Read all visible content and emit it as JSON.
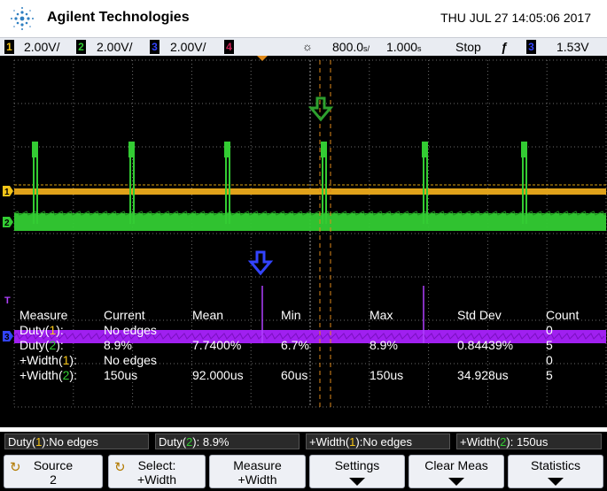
{
  "header": {
    "brand": "Agilent Technologies",
    "datetime": "THU JUL 27 14:05:06 2017"
  },
  "status": {
    "ch1": {
      "num": "1",
      "scale": "2.00V/",
      "color": "#f5c518"
    },
    "ch2": {
      "num": "2",
      "scale": "2.00V/",
      "color": "#33cc33"
    },
    "ch3": {
      "num": "3",
      "scale": "2.00V/",
      "color": "#3344ff"
    },
    "ch4": {
      "num": "4",
      "color": "#cc2255"
    },
    "timebase": "800.0",
    "timebase_unit_icon": "s-per-div",
    "delay": "1.000",
    "delay_unit_icon": "s",
    "run_state": "Stop",
    "trigger_source": "3",
    "trigger_level": "1.53V"
  },
  "measurements": {
    "headers": [
      "Measure",
      "Current",
      "Mean",
      "Min",
      "Max",
      "Std Dev",
      "Count"
    ],
    "rows": [
      {
        "name": "Duty(",
        "ch": "1",
        "tail": "):",
        "ch_color": "#f5c518",
        "current": "No edges",
        "mean": "",
        "min": "",
        "max": "",
        "std": "",
        "count": "0"
      },
      {
        "name": "Duty(",
        "ch": "2",
        "tail": "):",
        "ch_color": "#33cc33",
        "current": "8.9%",
        "mean": "7.7400%",
        "min": "6.7%",
        "max": "8.9%",
        "std": "0.84439%",
        "count": "5"
      },
      {
        "name": "+Width(",
        "ch": "1",
        "tail": "):",
        "ch_color": "#f5c518",
        "current": "No edges",
        "mean": "",
        "min": "",
        "max": "",
        "std": "",
        "count": "0"
      },
      {
        "name": "+Width(",
        "ch": "2",
        "tail": "):",
        "ch_color": "#33cc33",
        "current": "150us",
        "mean": "92.000us",
        "min": "60us",
        "max": "150us",
        "std": "34.928us",
        "count": "5"
      }
    ]
  },
  "readouts": [
    {
      "pre": "Duty(",
      "ch": "1",
      "post": "):No edges",
      "ch_color": "#f5c518"
    },
    {
      "pre": "Duty(",
      "ch": "2",
      "post": "): 8.9%",
      "ch_color": "#33cc33"
    },
    {
      "pre": "+Width(",
      "ch": "1",
      "post": "):No edges",
      "ch_color": "#f5c518"
    },
    {
      "pre": "+Width(",
      "ch": "2",
      "post": "): 150us",
      "ch_color": "#33cc33"
    }
  ],
  "softkeys": [
    {
      "line1": "Source",
      "line2": "2",
      "icon": "rotate-knob-icon"
    },
    {
      "line1": "Select:",
      "line2": "+Width",
      "icon": "rotate-knob-icon"
    },
    {
      "line1": "Measure",
      "line2": "+Width"
    },
    {
      "line1": "Settings",
      "icon": "down-arrow-icon"
    },
    {
      "line1": "Clear Meas",
      "icon": "down-arrow-icon"
    },
    {
      "line1": "Statistics",
      "icon": "down-arrow-icon"
    }
  ],
  "markers": {
    "ch1_label": "1",
    "ch2_label": "2",
    "ch3_label": "3",
    "trigger_label": "T"
  }
}
